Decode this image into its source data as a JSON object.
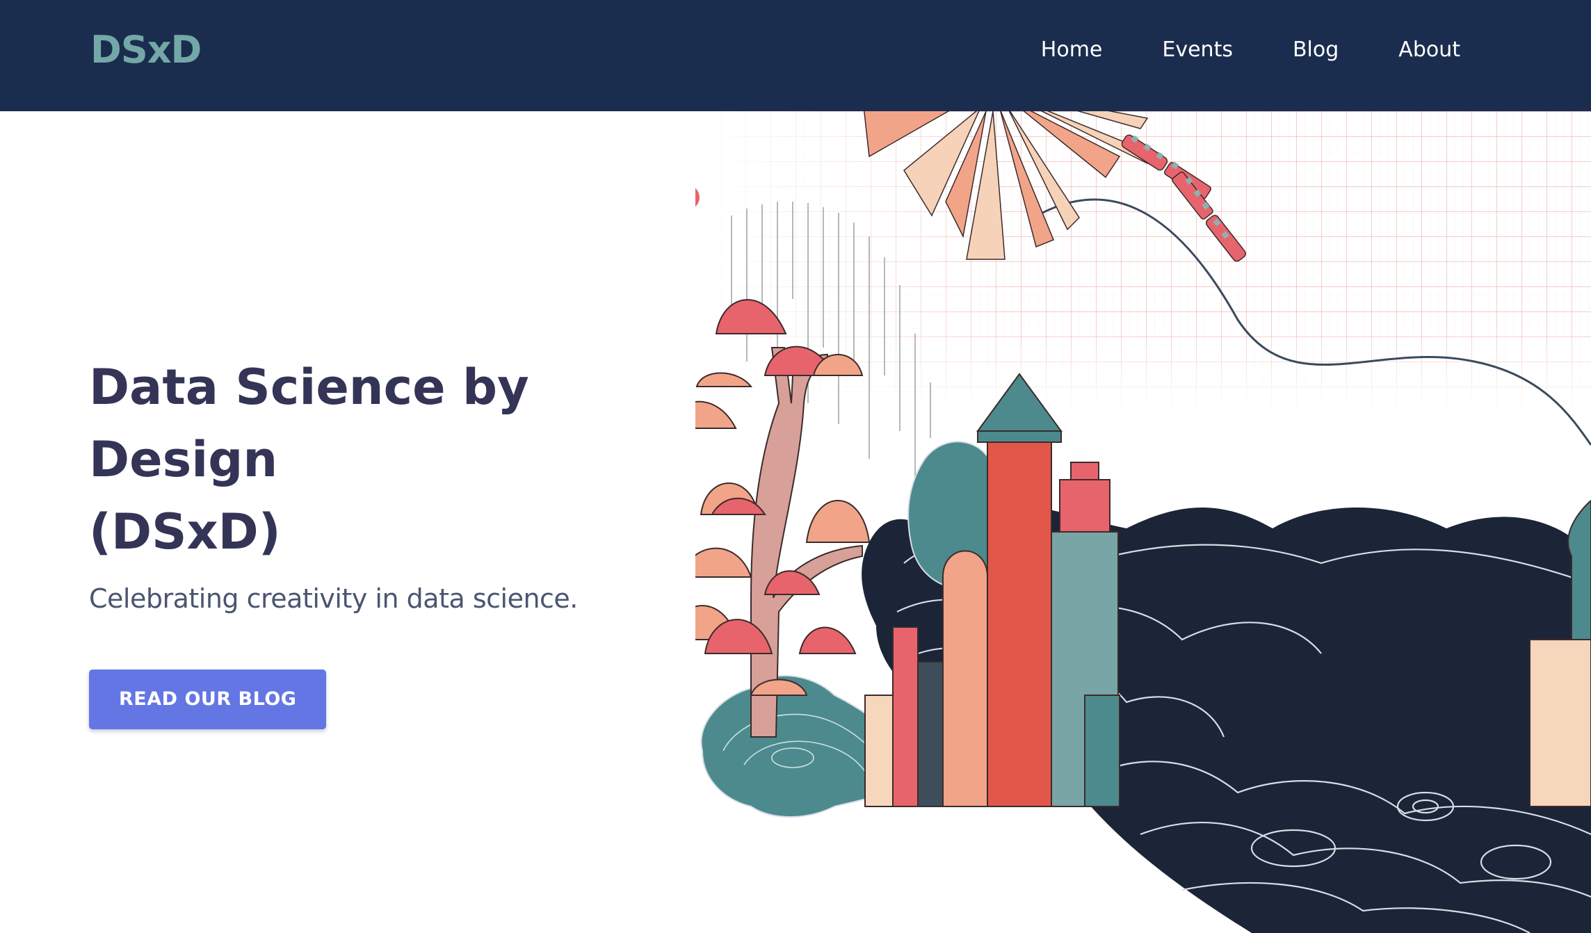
{
  "header": {
    "logo": "DSxD",
    "nav": [
      {
        "label": "Home"
      },
      {
        "label": "Events"
      },
      {
        "label": "Blog"
      },
      {
        "label": "About"
      }
    ]
  },
  "hero": {
    "title_line1": "Data Science by Design",
    "title_line2": "(DSxD)",
    "subtitle": "Celebrating creativity in data science.",
    "cta_label": "READ OUR BLOG"
  },
  "colors": {
    "header_bg": "#1b2d4e",
    "logo": "#74a8a8",
    "title": "#333456",
    "cta_bg": "#6476e4",
    "accent_pink": "#e8646c",
    "accent_salmon": "#f2a489",
    "accent_teal": "#4c8a8e",
    "navy": "#1b2537"
  },
  "illustration": {
    "name": "hero-illustration"
  }
}
